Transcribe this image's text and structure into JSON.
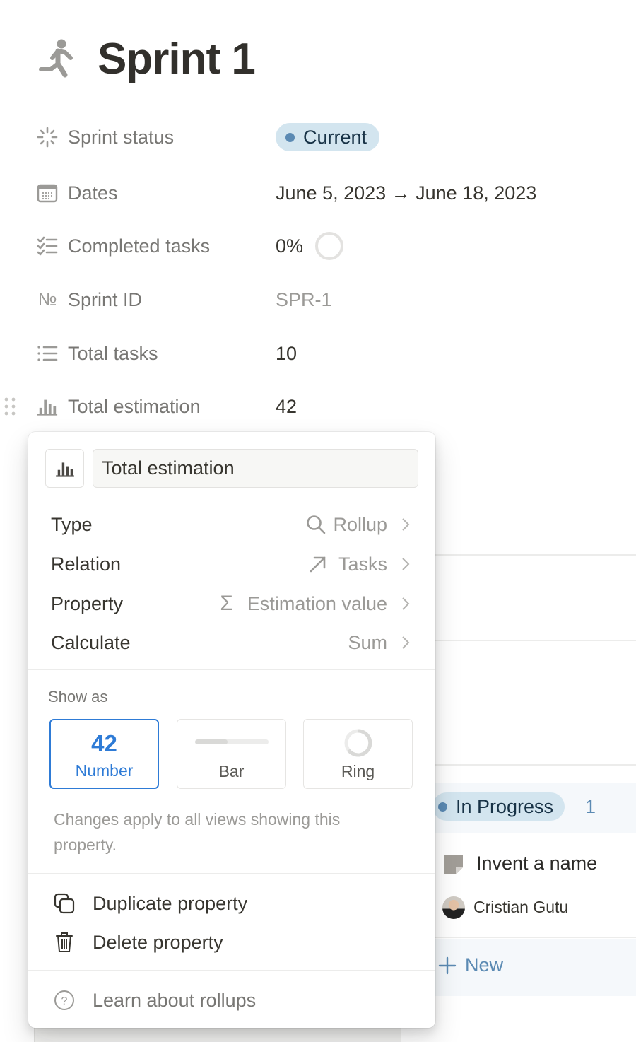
{
  "page": {
    "icon": "running-person-icon",
    "title": "Sprint 1"
  },
  "properties": [
    {
      "icon": "loading-spinner-icon",
      "label": "Sprint status",
      "value": "Current",
      "kind": "status",
      "status_color": "#5b8ab3",
      "pill_bg": "#d3e5ef"
    },
    {
      "icon": "calendar-icon",
      "label": "Dates",
      "value": "June 5, 2023 → June 18, 2023",
      "kind": "text"
    },
    {
      "icon": "checklist-icon",
      "label": "Completed tasks",
      "value": "0%",
      "kind": "ring",
      "progress": 0
    },
    {
      "icon": "number-sign-icon",
      "label": "Sprint ID",
      "value": "SPR-1",
      "kind": "muted"
    },
    {
      "icon": "list-icon",
      "label": "Total tasks",
      "value": "10",
      "kind": "text"
    },
    {
      "icon": "bar-chart-icon",
      "label": "Total estimation",
      "value": "42",
      "kind": "text"
    }
  ],
  "popup": {
    "property_name": "Total estimation",
    "icon": "bar-chart-icon",
    "config": [
      {
        "label": "Type",
        "icon": "search-icon",
        "value": "Rollup"
      },
      {
        "label": "Relation",
        "icon": "arrow-up-right-icon",
        "value": "Tasks"
      },
      {
        "label": "Property",
        "icon": "sigma-icon",
        "value": "Estimation value"
      },
      {
        "label": "Calculate",
        "icon": "",
        "value": "Sum"
      }
    ],
    "show_as": {
      "label": "Show as",
      "options": [
        {
          "label": "Number",
          "preview": "42",
          "selected": true
        },
        {
          "label": "Bar",
          "preview_fill": 0.45,
          "selected": false
        },
        {
          "label": "Ring",
          "selected": false
        }
      ]
    },
    "hint": "Changes apply to all views showing this property.",
    "actions": [
      {
        "icon": "duplicate-icon",
        "label": "Duplicate property"
      },
      {
        "icon": "trash-icon",
        "label": "Delete property"
      }
    ],
    "help": {
      "icon": "question-circle-icon",
      "label": "Learn about rollups"
    },
    "accent": "#2e7bd6"
  },
  "board": {
    "group": {
      "label": "In Progress",
      "count": "1",
      "color": "#5b8ab3"
    },
    "card": {
      "title": "Invent a name",
      "assignee": "Cristian Gutu"
    },
    "new_label": "New"
  }
}
